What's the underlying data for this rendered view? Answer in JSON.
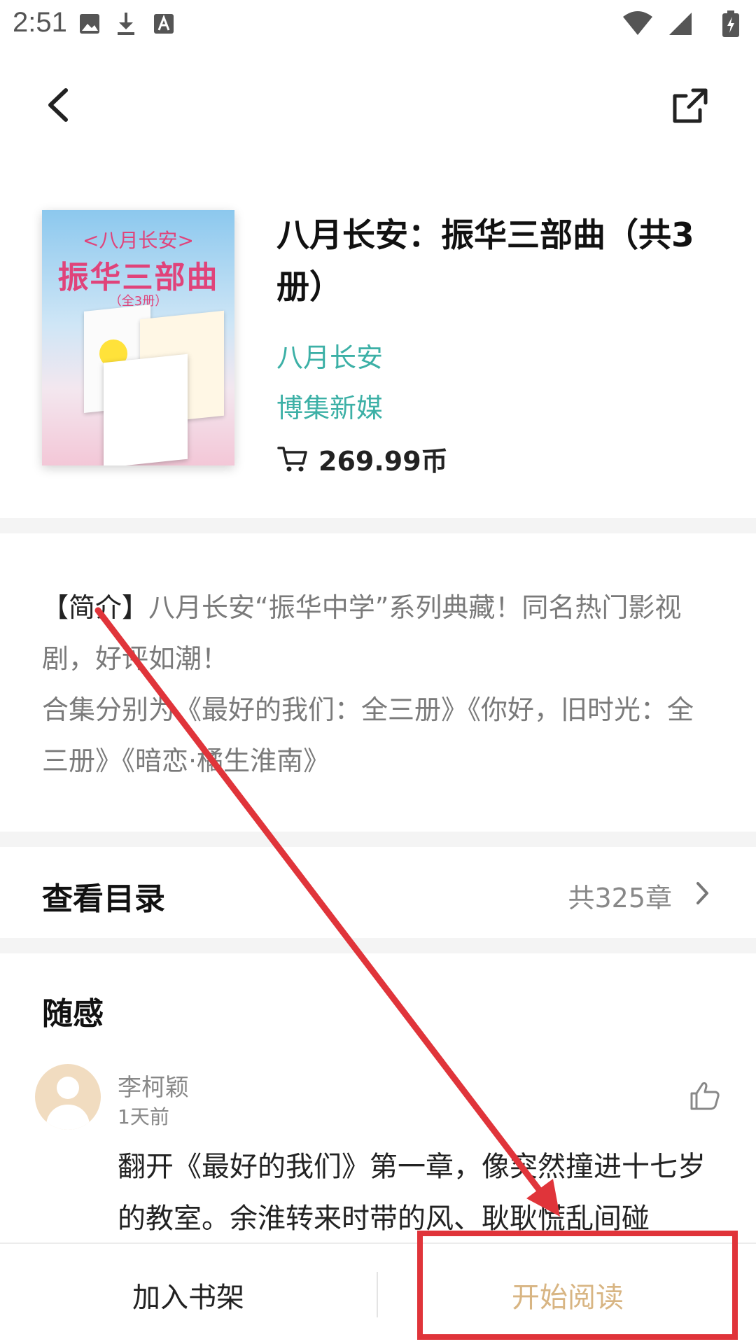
{
  "status_bar": {
    "time": "2:51",
    "icons": [
      "image-icon",
      "download-icon",
      "font-icon",
      "wifi-icon",
      "cellular-icon",
      "battery-icon"
    ]
  },
  "header": {
    "back_icon": "chevron-left-icon",
    "share_icon": "share-external-icon"
  },
  "book": {
    "cover": {
      "brand": "<八月长安>",
      "title": "振华三部曲",
      "subtitle": "（全3册）"
    },
    "title": "八月长安：振华三部曲（共3册）",
    "author": "八月长安",
    "publisher": "博集新媒",
    "price": "269.99币"
  },
  "intro": {
    "tag": "【简介】",
    "line1": "八月长安“振华中学”系列典藏！同名热门影视剧，好评如潮！",
    "line2": "合集分别为《最好的我们：全三册》《你好，旧时光：全三册》《暗恋·橘生淮南》"
  },
  "toc": {
    "title": "查看目录",
    "count": "共325章"
  },
  "thoughts": {
    "title": "随感",
    "comment": {
      "name": "李柯颖",
      "time": "1天前",
      "text": "翻开《最好的我们》第一章，像突然撞进十七岁的教室。余淮转来时带的风、耿耿慌乱间碰"
    }
  },
  "bottom_bar": {
    "add_shelf": "加入书架",
    "start_read": "开始阅读"
  },
  "colors": {
    "accent_teal": "#3cb0a6",
    "start_read_gold": "#d8b583",
    "annotation_red": "#e0343a"
  }
}
